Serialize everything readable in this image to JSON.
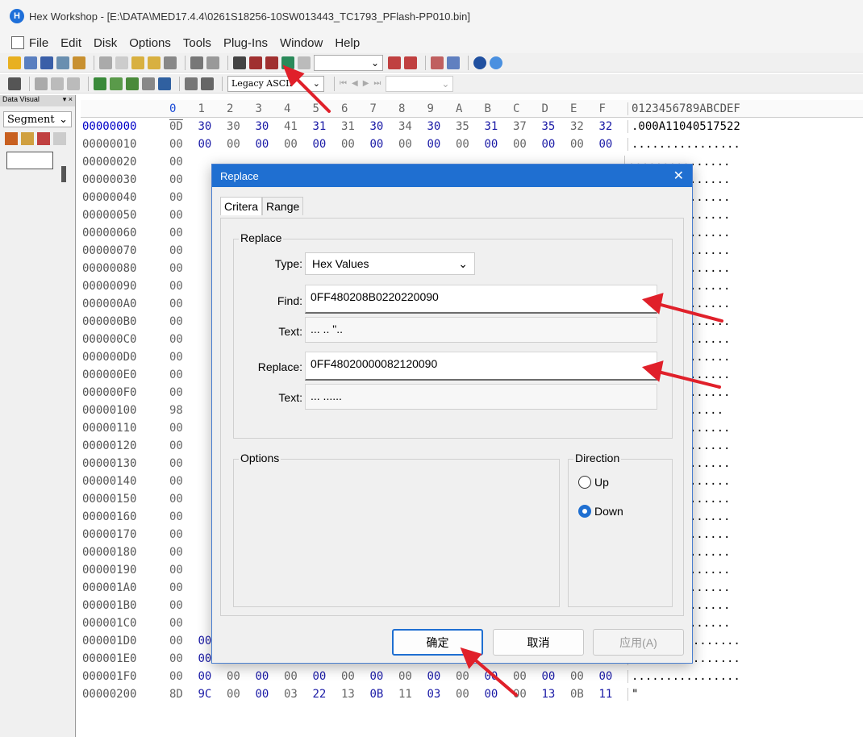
{
  "window": {
    "title": "Hex Workshop - [E:\\DATA\\MED17.4.4\\0261S18256-10SW013443_TC1793_PFlash-PP010.bin]"
  },
  "menu": [
    "File",
    "Edit",
    "Disk",
    "Options",
    "Tools",
    "Plug-Ins",
    "Window",
    "Help"
  ],
  "toolbar": {
    "ascii_mode": "Legacy ASCII"
  },
  "left_panel": {
    "header": "Data Visual",
    "segment": "Segment"
  },
  "hex": {
    "header_cols": [
      "0",
      "1",
      "2",
      "3",
      "4",
      "5",
      "6",
      "7",
      "8",
      "9",
      "A",
      "B",
      "C",
      "D",
      "E",
      "F"
    ],
    "ascii_header": "0123456789ABCDEF",
    "rows": [
      {
        "addr": "00000000",
        "bytes": [
          "0D",
          "30",
          "30",
          "30",
          "41",
          "31",
          "31",
          "30",
          "34",
          "30",
          "35",
          "31",
          "37",
          "35",
          "32",
          "32"
        ],
        "ascii": ".000A11040517522"
      },
      {
        "addr": "00000010",
        "bytes": [
          "00",
          "00",
          "00",
          "00",
          "00",
          "00",
          "00",
          "00",
          "00",
          "00",
          "00",
          "00",
          "00",
          "00",
          "00",
          "00"
        ],
        "ascii": "................"
      },
      {
        "addr": "00000020",
        "bytes": [
          "00"
        ],
        "ascii": "..............."
      },
      {
        "addr": "00000030",
        "bytes": [
          "00"
        ],
        "ascii": "..............."
      },
      {
        "addr": "00000040",
        "bytes": [
          "00"
        ],
        "ascii": "..............."
      },
      {
        "addr": "00000050",
        "bytes": [
          "00"
        ],
        "ascii": "..............."
      },
      {
        "addr": "00000060",
        "bytes": [
          "00"
        ],
        "ascii": "..............."
      },
      {
        "addr": "00000070",
        "bytes": [
          "00"
        ],
        "ascii": "..............."
      },
      {
        "addr": "00000080",
        "bytes": [
          "00"
        ],
        "ascii": "..............."
      },
      {
        "addr": "00000090",
        "bytes": [
          "00"
        ],
        "ascii": "..............."
      },
      {
        "addr": "000000A0",
        "bytes": [
          "00"
        ],
        "ascii": "..............."
      },
      {
        "addr": "000000B0",
        "bytes": [
          "00"
        ],
        "ascii": "..............."
      },
      {
        "addr": "000000C0",
        "bytes": [
          "00"
        ],
        "ascii": "..............."
      },
      {
        "addr": "000000D0",
        "bytes": [
          "00"
        ],
        "ascii": "..............."
      },
      {
        "addr": "000000E0",
        "bytes": [
          "00"
        ],
        "ascii": "..............."
      },
      {
        "addr": "000000F0",
        "bytes": [
          "00"
        ],
        "ascii": "..............."
      },
      {
        "addr": "00000100",
        "bytes": [
          "98"
        ],
        "ascii": "C....C........"
      },
      {
        "addr": "00000110",
        "bytes": [
          "00"
        ],
        "ascii": "..............."
      },
      {
        "addr": "00000120",
        "bytes": [
          "00"
        ],
        "ascii": "..............."
      },
      {
        "addr": "00000130",
        "bytes": [
          "00"
        ],
        "ascii": "..............."
      },
      {
        "addr": "00000140",
        "bytes": [
          "00"
        ],
        "ascii": "..............."
      },
      {
        "addr": "00000150",
        "bytes": [
          "00"
        ],
        "ascii": "..............."
      },
      {
        "addr": "00000160",
        "bytes": [
          "00"
        ],
        "ascii": "..............."
      },
      {
        "addr": "00000170",
        "bytes": [
          "00"
        ],
        "ascii": "..............."
      },
      {
        "addr": "00000180",
        "bytes": [
          "00"
        ],
        "ascii": "..............."
      },
      {
        "addr": "00000190",
        "bytes": [
          "00"
        ],
        "ascii": "..............."
      },
      {
        "addr": "000001A0",
        "bytes": [
          "00"
        ],
        "ascii": "..............."
      },
      {
        "addr": "000001B0",
        "bytes": [
          "00"
        ],
        "ascii": "..............."
      },
      {
        "addr": "000001C0",
        "bytes": [
          "00"
        ],
        "ascii": "..............."
      },
      {
        "addr": "000001D0",
        "bytes": [
          "00",
          "00",
          "00",
          "00",
          "00",
          "00",
          "00",
          "00",
          "00",
          "00",
          "00",
          "00",
          "00",
          "00",
          "00",
          "00"
        ],
        "ascii": "................"
      },
      {
        "addr": "000001E0",
        "bytes": [
          "00",
          "00",
          "00",
          "00",
          "00",
          "00",
          "00",
          "00",
          "00",
          "00",
          "00",
          "00",
          "00",
          "00",
          "00",
          "00"
        ],
        "ascii": "................"
      },
      {
        "addr": "000001F0",
        "bytes": [
          "00",
          "00",
          "00",
          "00",
          "00",
          "00",
          "00",
          "00",
          "00",
          "00",
          "00",
          "00",
          "00",
          "00",
          "00",
          "00"
        ],
        "ascii": "................"
      },
      {
        "addr": "00000200",
        "bytes": [
          "8D",
          "9C",
          "00",
          "00",
          "03",
          "22",
          "13",
          "0B",
          "11",
          "03",
          "00",
          "00",
          "00",
          "13",
          "0B",
          "11"
        ],
        "ascii": "       \""
      }
    ]
  },
  "dialog": {
    "title": "Replace",
    "tabs": [
      "Critera",
      "Range"
    ],
    "replace_group": "Replace",
    "type_label": "Type:",
    "type_value": "Hex Values",
    "find_label": "Find:",
    "find_value": "0FF480208B0220220090",
    "text_label": "Text:",
    "find_text": "... .. \"..",
    "replace_label": "Replace:",
    "replace_value": "0FF48020000082120090",
    "replace_text": "... ......",
    "options_group": "Options",
    "direction_group": "Direction",
    "up_label": "Up",
    "down_label": "Down",
    "direction_selected": "Down",
    "ok_label": "确定",
    "cancel_label": "取消",
    "apply_label": "应用(A)"
  },
  "colors": {
    "accent": "#1f6fd1",
    "annotation_arrow": "#e0202a"
  }
}
